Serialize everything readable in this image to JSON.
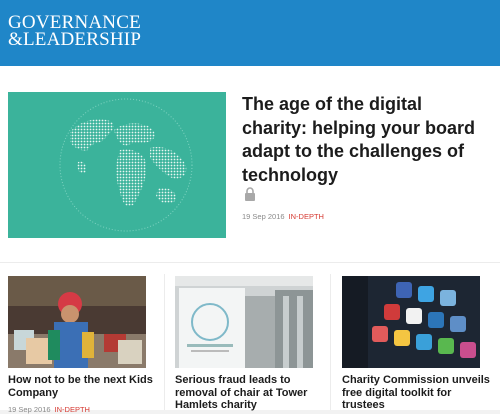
{
  "site": {
    "logo_line1": "GOVERNANCE",
    "logo_line2": "&LEADERSHIP"
  },
  "featured": {
    "title": "The age of the digital charity: helping your board adapt to the challenges of technology",
    "date": "19 Sep 2016",
    "tag": "IN-DEPTH",
    "icon": "lock-icon",
    "image": "globe-illustration"
  },
  "articles": [
    {
      "title": "How not to be the next Kids Company",
      "date": "19 Sep 2016",
      "tag": "IN-DEPTH",
      "image": "woman-with-gifts"
    },
    {
      "title": "Serious fraud leads to removal of chair at Tower Hamlets charity",
      "date": "",
      "tag": "",
      "image": "one-building-sign"
    },
    {
      "title": "Charity Commission unveils free digital toolkit for trustees",
      "date": "",
      "tag": "",
      "image": "smartphone-apps"
    }
  ],
  "colors": {
    "header": "#1f86c8",
    "hero_bg": "#3bb39b",
    "tag": "#d63a32"
  }
}
